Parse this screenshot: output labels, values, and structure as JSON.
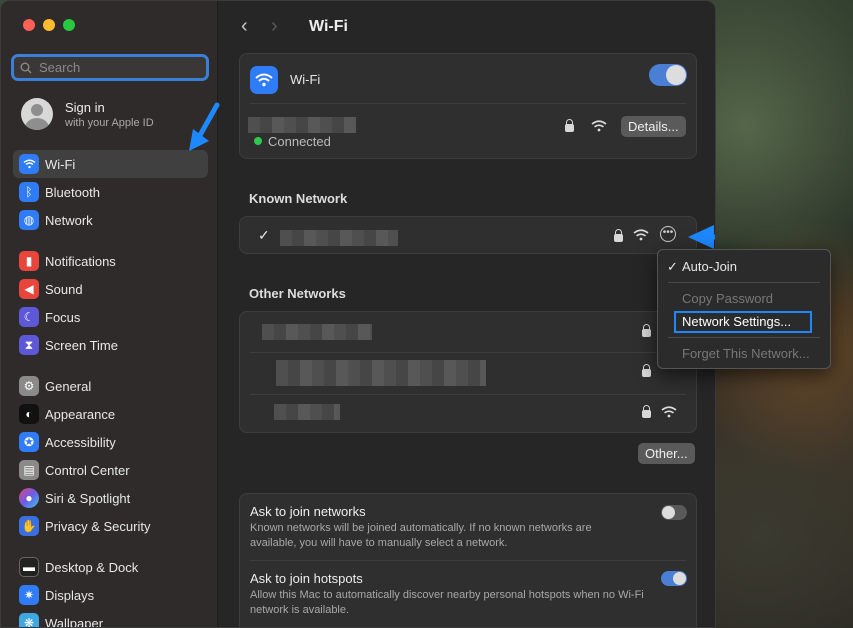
{
  "search": {
    "placeholder": "Search"
  },
  "account": {
    "name": "Sign in",
    "sub": "with your Apple ID"
  },
  "sidebar": {
    "group1": [
      {
        "label": "Wi-Fi",
        "icon": "wifi-icon",
        "color": "#2f7cf6"
      },
      {
        "label": "Bluetooth",
        "icon": "bluetooth-icon",
        "color": "#2f7cf6"
      },
      {
        "label": "Network",
        "icon": "globe-icon",
        "color": "#2f7cf6"
      }
    ],
    "group2": [
      {
        "label": "Notifications",
        "icon": "bell-icon",
        "color": "#e8453c"
      },
      {
        "label": "Sound",
        "icon": "speaker-icon",
        "color": "#e8453c"
      },
      {
        "label": "Focus",
        "icon": "moon-icon",
        "color": "#5d58d8"
      },
      {
        "label": "Screen Time",
        "icon": "hourglass-icon",
        "color": "#5d58d8"
      }
    ],
    "group3": [
      {
        "label": "General",
        "icon": "gear-icon",
        "color": "#8a8a8a"
      },
      {
        "label": "Appearance",
        "icon": "appearance-icon",
        "color": "#111111"
      },
      {
        "label": "Accessibility",
        "icon": "accessibility-icon",
        "color": "#2f7cf6"
      },
      {
        "label": "Control Center",
        "icon": "control-center-icon",
        "color": "#8a8a8a"
      },
      {
        "label": "Siri & Spotlight",
        "icon": "siri-icon",
        "color": "#a04fd6"
      },
      {
        "label": "Privacy & Security",
        "icon": "hand-icon",
        "color": "#3b6fe0"
      }
    ],
    "group4": [
      {
        "label": "Desktop & Dock",
        "icon": "dock-icon",
        "color": "#222222"
      },
      {
        "label": "Displays",
        "icon": "display-icon",
        "color": "#2f7cf6"
      },
      {
        "label": "Wallpaper",
        "icon": "wallpaper-icon",
        "color": "#3fa8e0"
      }
    ]
  },
  "header": {
    "title": "Wi-Fi"
  },
  "wifi": {
    "label": "Wi-Fi",
    "status": "Connected",
    "details_label": "Details..."
  },
  "known": {
    "title": "Known Network",
    "check": "✓"
  },
  "other": {
    "title": "Other Networks",
    "button": "Other..."
  },
  "settings": {
    "join_networks": {
      "title": "Ask to join networks",
      "desc": "Known networks will be joined automatically. If no known networks are available, you will have to manually select a network."
    },
    "join_hotspots": {
      "title": "Ask to join hotspots",
      "desc": "Allow this Mac to automatically discover nearby personal hotspots when no Wi-Fi network is available."
    }
  },
  "context_menu": {
    "check": "✓",
    "auto_join": "Auto-Join",
    "copy_password": "Copy Password",
    "network_settings": "Network Settings...",
    "forget": "Forget This Network..."
  },
  "accent": "#2f7cf6",
  "highlight": "#1e88ff"
}
